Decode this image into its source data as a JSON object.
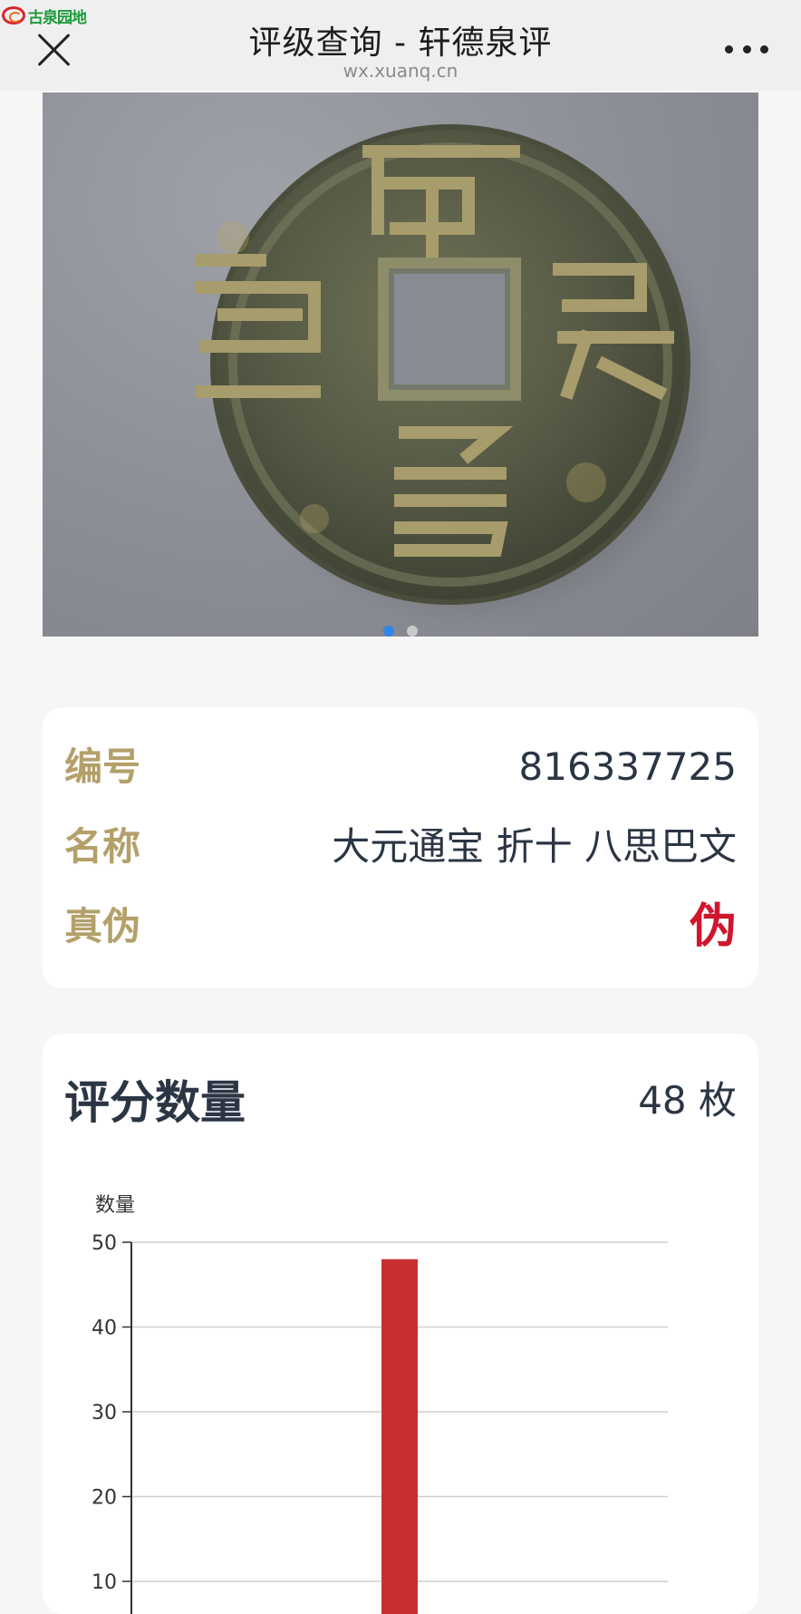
{
  "nav": {
    "logo_text": "古泉园地",
    "title": "评级查询 - 轩德泉评",
    "url": "wx.xuanq.cn"
  },
  "carousel": {
    "image": "coin-photo",
    "pages": 2,
    "active_page": 1
  },
  "info": {
    "rows": [
      {
        "label": "编号",
        "value": "816337725"
      },
      {
        "label": "名称",
        "value": "大元通宝 折十 八思巴文"
      },
      {
        "label": "真伪",
        "value": "伪"
      }
    ]
  },
  "score": {
    "title": "评分数量",
    "count": "48 枚"
  },
  "chart_data": {
    "type": "bar",
    "ylabel": "数量",
    "ylim": [
      0,
      50
    ],
    "yticks": [
      10,
      20,
      30,
      40,
      50
    ],
    "categories": [
      ""
    ],
    "values": [
      48
    ],
    "bar_color": "#c7302f",
    "grid": true
  },
  "colors": {
    "label_gold": "#b3a06a",
    "fake_red": "#d0162c",
    "dot_active": "#2f87ea"
  }
}
